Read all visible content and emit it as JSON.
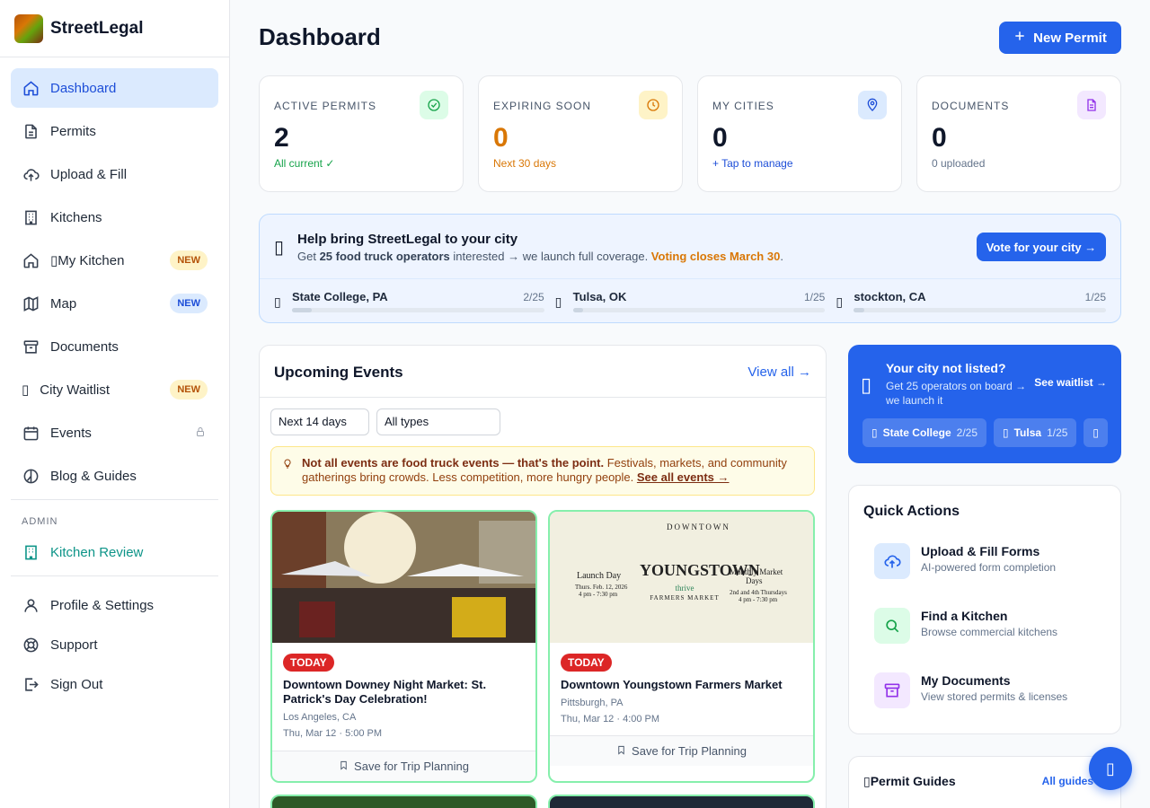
{
  "brand": {
    "name": "StreetLegal"
  },
  "sidebar": {
    "items": [
      {
        "label": "Dashboard",
        "icon": "home-icon",
        "active": true
      },
      {
        "label": "Permits",
        "icon": "document-icon"
      },
      {
        "label": "Upload & Fill",
        "icon": "upload-cloud-icon"
      },
      {
        "label": "Kitchens",
        "icon": "building-icon"
      },
      {
        "label": "My Kitchen",
        "icon": "home-icon",
        "glyph": "▯",
        "badge": "NEW"
      },
      {
        "label": "Map",
        "icon": "map-icon",
        "badge": "NEW"
      },
      {
        "label": "Documents",
        "icon": "archive-icon"
      },
      {
        "label": "City Waitlist",
        "icon": "placeholder-glyph-icon",
        "glyph": "▯",
        "badge": "NEW"
      },
      {
        "label": "Events",
        "icon": "calendar-icon",
        "locked": true
      },
      {
        "label": "Blog & Guides",
        "icon": "book-icon"
      }
    ],
    "admin_label": "ADMIN",
    "admin_items": [
      {
        "label": "Kitchen Review",
        "icon": "building-icon"
      }
    ],
    "bottom_items": [
      {
        "label": "Profile & Settings",
        "icon": "user-icon"
      },
      {
        "label": "Support",
        "icon": "lifebuoy-icon"
      },
      {
        "label": "Sign Out",
        "icon": "sign-out-icon"
      }
    ]
  },
  "header": {
    "title": "Dashboard",
    "new_permit_label": "New Permit"
  },
  "stats": [
    {
      "label": "ACTIVE PERMITS",
      "value": "2",
      "sub": "All current ✓",
      "icon": "check-circle-icon",
      "color": "#16a34a"
    },
    {
      "label": "EXPIRING SOON",
      "value": "0",
      "sub": "Next 30 days",
      "icon": "clock-icon",
      "color": "#d97706"
    },
    {
      "label": "MY CITIES",
      "value": "0",
      "sub": "+ Tap to manage",
      "icon": "map-pin-icon",
      "color": "#1d4ed8"
    },
    {
      "label": "DOCUMENTS",
      "value": "0",
      "sub": "0 uploaded",
      "icon": "file-icon",
      "color": "#64748b"
    }
  ],
  "help": {
    "glyph": "▯",
    "title": "Help bring StreetLegal to your city",
    "text_prefix": "Get ",
    "text_bold": "25 food truck operators",
    "text_mid": " interested → we launch full coverage. ",
    "text_orange": "Voting closes March 30",
    "text_suffix": ".",
    "vote_label": "Vote for your city →",
    "cities": [
      {
        "name": "State College, PA",
        "count": "2/25",
        "progress": 0.08,
        "glyph": "▯"
      },
      {
        "name": "Tulsa, OK",
        "count": "1/25",
        "progress": 0.04,
        "glyph": "▯"
      },
      {
        "name": "stockton, CA",
        "count": "1/25",
        "progress": 0.04,
        "glyph": "▯"
      }
    ]
  },
  "events": {
    "title": "Upcoming Events",
    "view_all": "View all →",
    "filter_range": "Next 14 days",
    "filter_type": "All types",
    "notice_bold": "Not all events are food truck events — that's the point.",
    "notice_text": " Festivals, markets, and community gatherings bring crowds. Less competition, more hungry people. ",
    "notice_link": "See all events →",
    "cards": [
      {
        "badge": "TODAY",
        "name": "Downtown Downey Night Market: St. Patrick's Day Celebration!",
        "location": "Los Angeles, CA",
        "date": "Thu, Mar 12 · 5:00 PM",
        "save": "Save for Trip Planning"
      },
      {
        "badge": "TODAY",
        "name": "Downtown Youngstown Farmers Market",
        "location": "Pittsburgh, PA",
        "date": "Thu, Mar 12 · 4:00 PM",
        "save": "Save for Trip Planning"
      }
    ],
    "poster": {
      "line1": "DOWNTOWN",
      "line2": "YOUNGSTOWN",
      "line3": "thrive",
      "line4": "FARMERS MARKET",
      "left1": "Launch Day",
      "left2": "Thurs. Feb. 12, 2026",
      "left3": "4 pm - 7:30 pm",
      "right1": "Monthly Market",
      "right2": "Days",
      "right3": "2nd and 4th Thursdays",
      "right4": "4 pm - 7:30 pm"
    }
  },
  "waitlist": {
    "glyph": "▯",
    "title": "Your city not listed?",
    "text": "Get 25 operators on board → we launch it",
    "link": "See waitlist →",
    "chips": [
      {
        "name": "State College",
        "count": "2/25",
        "glyph": "▯"
      },
      {
        "name": "Tulsa",
        "count": "1/25",
        "glyph": "▯"
      },
      {
        "name": "",
        "count": "",
        "glyph": "▯"
      }
    ]
  },
  "quick_actions": {
    "title": "Quick Actions",
    "items": [
      {
        "name": "Upload & Fill Forms",
        "desc": "AI-powered form completion",
        "icon": "upload-cloud-icon"
      },
      {
        "name": "Find a Kitchen",
        "desc": "Browse commercial kitchens",
        "icon": "search-icon"
      },
      {
        "name": "My Documents",
        "desc": "View stored permits & licenses",
        "icon": "archive-icon"
      }
    ]
  },
  "guides": {
    "title": "▯Permit Guides",
    "link": "All guides"
  },
  "fab": {
    "glyph": "▯"
  }
}
